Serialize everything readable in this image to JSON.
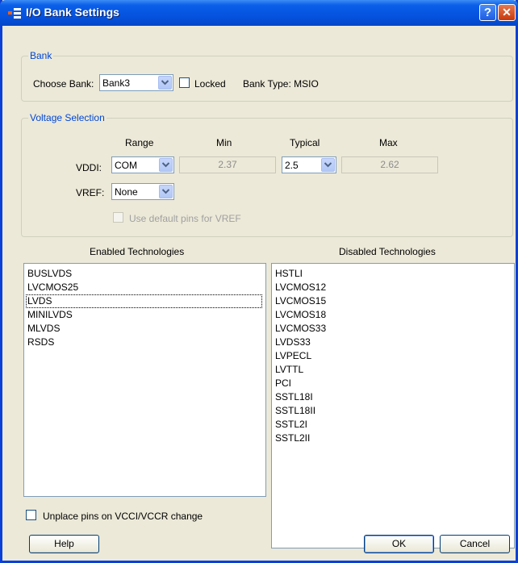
{
  "window": {
    "title": "I/O Bank Settings"
  },
  "bank": {
    "legend": "Bank",
    "choose_label": "Choose Bank:",
    "selected": "Bank3",
    "locked_label": "Locked",
    "locked_checked": false,
    "type_text": "Bank Type: MSIO"
  },
  "voltage": {
    "legend": "Voltage Selection",
    "headers": {
      "range": "Range",
      "min": "Min",
      "typical": "Typical",
      "max": "Max"
    },
    "vddi": {
      "label": "VDDI:",
      "range": "COM",
      "min": "2.37",
      "typical": "2.5",
      "max": "2.62"
    },
    "vref": {
      "label": "VREF:",
      "range": "None"
    },
    "default_pins_label": "Use default pins for VREF",
    "default_pins_enabled": false
  },
  "enabled": {
    "header": "Enabled Technologies",
    "items": [
      "BUSLVDS",
      "LVCMOS25",
      "LVDS",
      "MINILVDS",
      "MLVDS",
      "RSDS"
    ]
  },
  "disabled": {
    "header": "Disabled Technologies",
    "items": [
      "HSTLI",
      "LVCMOS12",
      "LVCMOS15",
      "LVCMOS18",
      "LVCMOS33",
      "LVDS33",
      "LVPECL",
      "LVTTL",
      "PCI",
      "SSTL18I",
      "SSTL18II",
      "SSTL2I",
      "SSTL2II"
    ]
  },
  "unplace": {
    "label": "Unplace pins on VCCI/VCCR change",
    "checked": false
  },
  "buttons": {
    "help": "Help",
    "ok": "OK",
    "cancel": "Cancel"
  }
}
